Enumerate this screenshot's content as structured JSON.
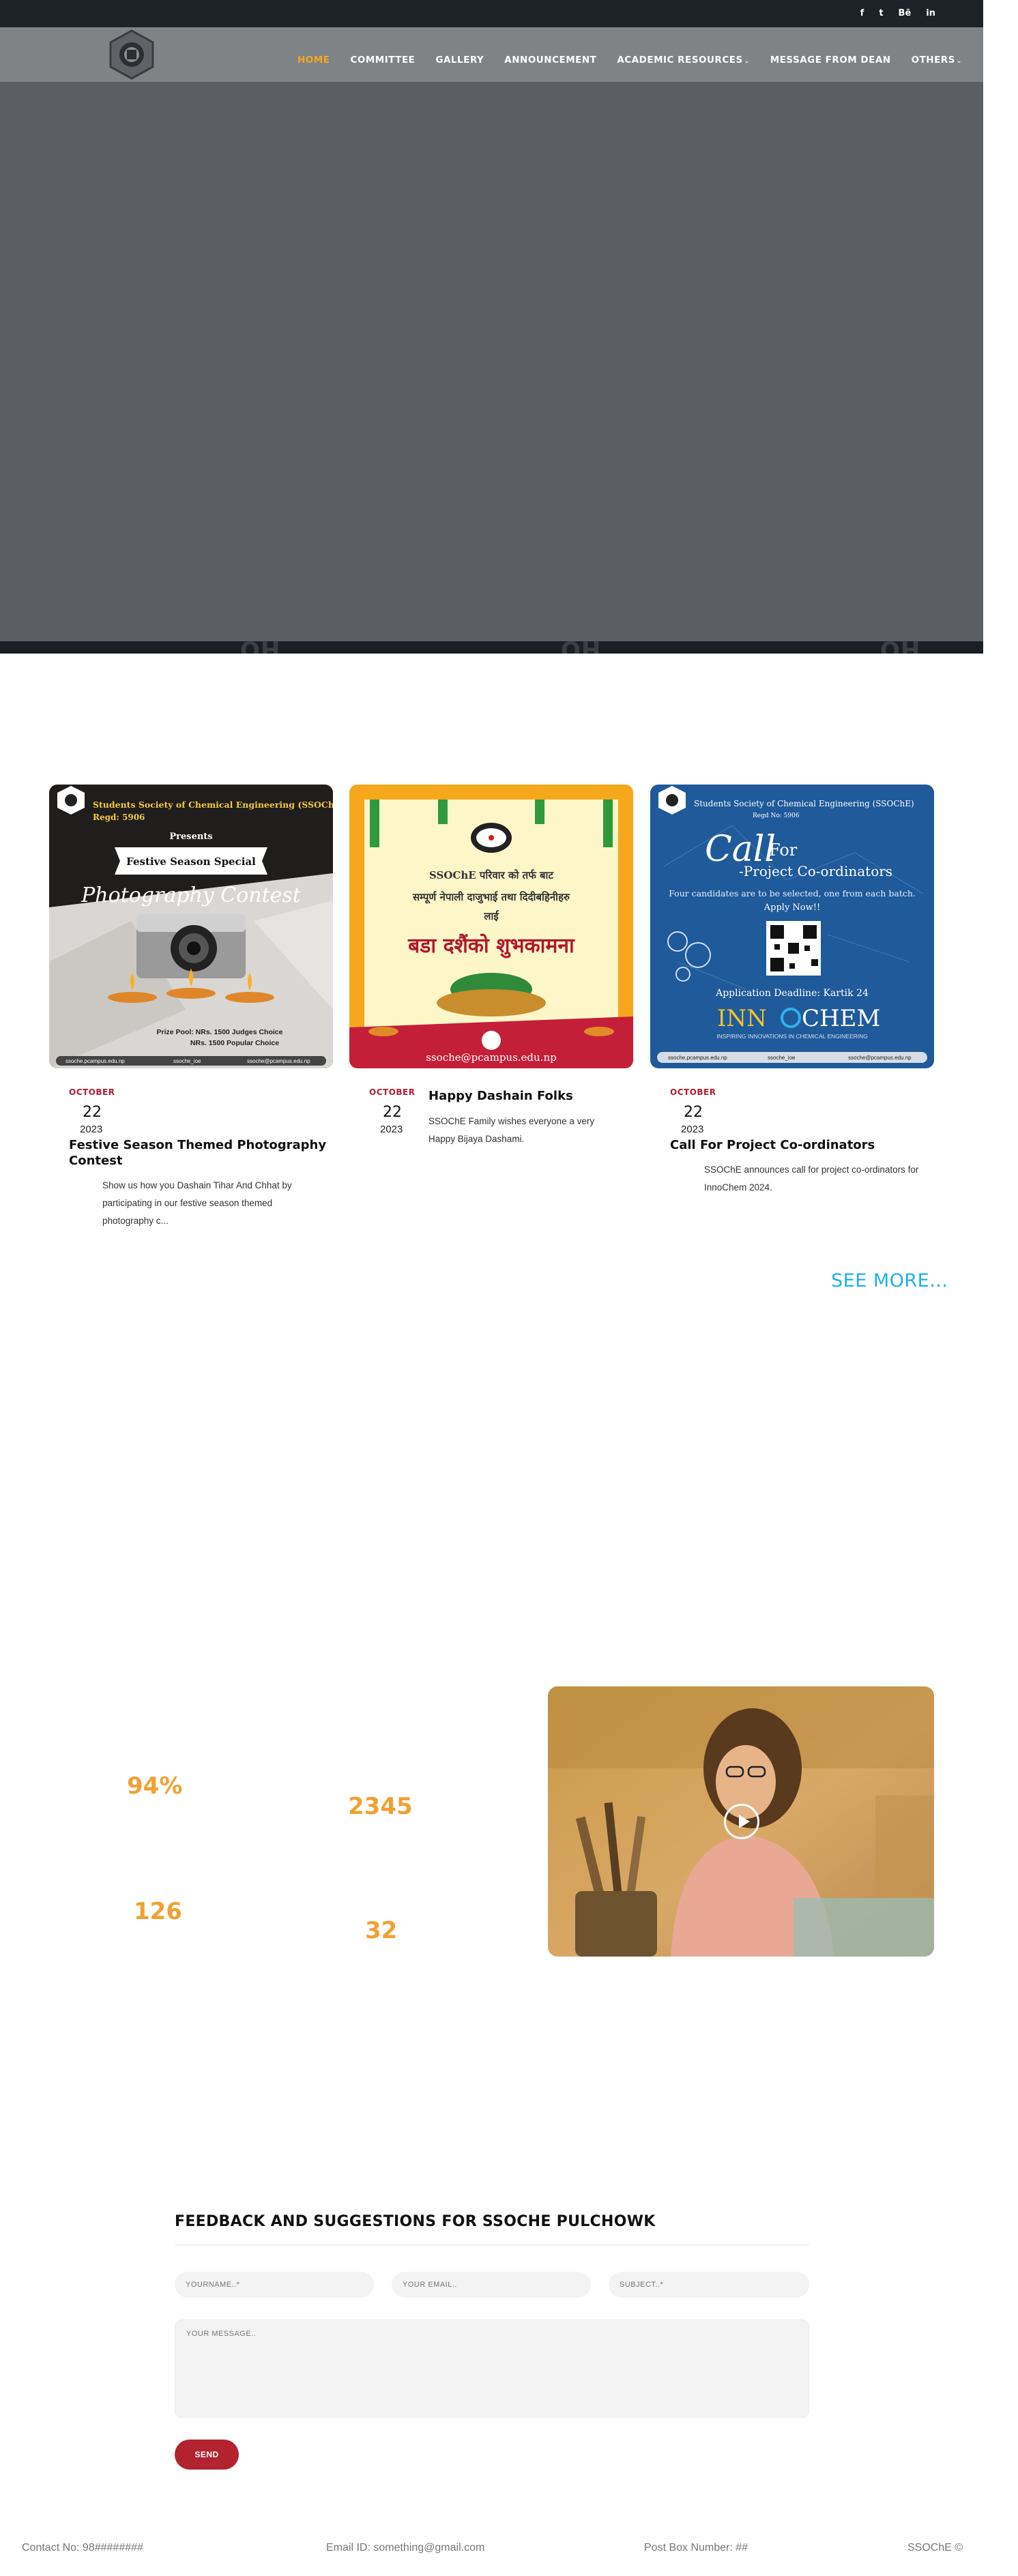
{
  "social": [
    "f",
    "t",
    "Bē",
    "in"
  ],
  "social_icons": [
    "facebook-icon",
    "twitter-icon",
    "behance-icon",
    "linkedin-icon"
  ],
  "nav": {
    "items": [
      "HOME",
      "COMMITTEE",
      "GALLERY",
      "ANNOUNCEMENT",
      "ACADEMIC RESOURCES",
      "MESSAGE FROM DEAN",
      "OTHERS"
    ],
    "active": "HOME",
    "dropdown_items": [
      "ACADEMIC RESOURCES",
      "OTHERS"
    ]
  },
  "news": [
    {
      "month": "OCTOBER",
      "day": "22",
      "year": "2023",
      "title": "Festive Season Themed Photography Contest",
      "desc": "Show us how you Dashain Tihar And Chhat by participating in our festive season themed photography c...",
      "image": {
        "org": "Students Society of Chemical Engineering (SSOChE)",
        "regd": "Regd: 5906",
        "presents": "Presents",
        "banner": "Festive Season Special",
        "headline": "Photography Contest",
        "prize1": "Prize Pool: NRs. 1500 Judges Choice",
        "prize2": "NRs. 1500 Popular Choice",
        "footer": [
          "ssoche.pcampus.edu.np",
          "ssoche_ioe",
          "ssoche@pcampus.edu.np"
        ]
      }
    },
    {
      "month": "OCTOBER",
      "day": "22",
      "year": "2023",
      "title": "Happy Dashain Folks",
      "desc": "SSOChE Family wishes everyone a very Happy Bijaya Dashami.",
      "image": {
        "line1": "SSOChE परिवार को तर्फ बाट",
        "line2": "सम्पूर्ण नेपाली दाजुभाई तथा दिदीबहिनीहरु",
        "line3": "लाई",
        "headline": "बडा दशैंको शुभकामना",
        "email": "ssoche@pcampus.edu.np"
      }
    },
    {
      "month": "OCTOBER",
      "day": "22",
      "year": "2023",
      "title": "Call For Project Co-ordinators",
      "desc": "SSOChE announces call for project co-ordinators for InnoChem 2024.",
      "image": {
        "org": "Students Society of Chemical Engineering (SSOChE)",
        "regd": "Regd No: 5906",
        "call": "Call",
        "for": "For",
        "sub": "-Project Co-ordinators",
        "note": "Four candidates are to be selected, one from each batch.",
        "apply": "Apply Now!!",
        "deadline": "Application Deadline: Kartik 24",
        "brand1": "INN",
        "brand2": "CHEM",
        "tagline": "INSPIRING INNOVATIONS IN CHEMICAL ENGINEERING",
        "footer": [
          "ssoche.pcampus.edu.np",
          "ssoche_ioe",
          "ssoche@pcampus.edu.np"
        ]
      }
    }
  ],
  "see_more": "SEE MORE...",
  "stats": [
    "94%",
    "2345",
    "126",
    "32"
  ],
  "feedback": {
    "title": "FEEDBACK AND SUGGESTIONS FOR SSOCHE PULCHOWK",
    "name_placeholder": "YOURNAME..*",
    "email_placeholder": "YOUR EMAIL..",
    "subject_placeholder": "SUBJECT..*",
    "message_placeholder": "YOUR MESSAGE..",
    "send": "SEND"
  },
  "footer": {
    "contact": "Contact No: 98########",
    "email": "Email ID: something@gmail.com",
    "pobox": "Post Box Number: ##",
    "copyright": "SSOChE ©"
  },
  "colors": {
    "accent_orange": "#f5a623",
    "link_blue": "#1db0e8",
    "send_red": "#b3222f",
    "month_red": "#b01c2e"
  }
}
